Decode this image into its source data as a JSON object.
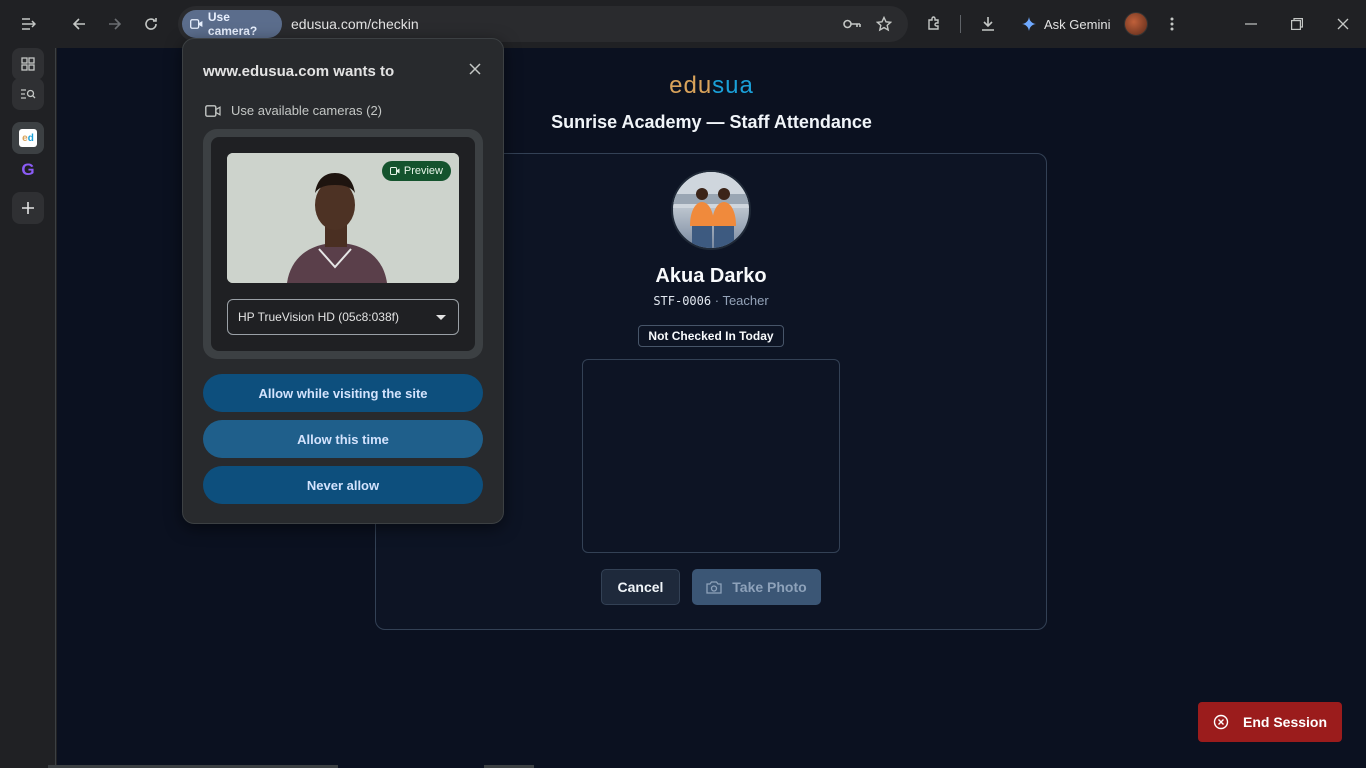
{
  "browser": {
    "camera_chip_label": "Use camera?",
    "url": "edusua.com/checkin",
    "gemini_label": "Ask Gemini"
  },
  "popup": {
    "title": "www.edusua.com wants to",
    "camera_line": "Use available cameras (2)",
    "preview_badge": "Preview",
    "camera_select_value": "HP TrueVision HD (05c8:038f)",
    "allow_visiting": "Allow while visiting the site",
    "allow_once": "Allow this time",
    "never_allow": "Never allow"
  },
  "page": {
    "logo_part1": "edu",
    "logo_part2": "sua",
    "title": "Sunrise Academy — Staff Attendance",
    "staff": {
      "name": "Akua Darko",
      "id": "STF-0006",
      "separator": " · ",
      "role": "Teacher",
      "status": "Not Checked In Today"
    },
    "cancel_label": "Cancel",
    "take_photo_label": "Take Photo",
    "end_session_label": "End Session"
  },
  "colors": {
    "page_bg": "#0b1120",
    "end_session": "#9b1c1c",
    "allow_button": "#0d4f7d",
    "logo_orange": "#d9a35b",
    "logo_blue": "#1aa0d8"
  }
}
